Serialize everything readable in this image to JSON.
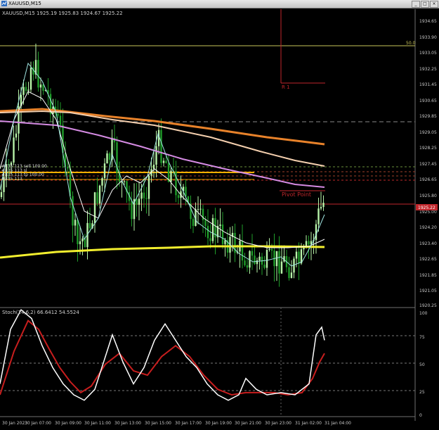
{
  "window": {
    "title": "XAUUSD,M15",
    "buttons": {
      "minimize": "_",
      "restore": "□",
      "close": "×"
    }
  },
  "main_panel": {
    "header": "XAUUSD,M15  1925.19 1925.83 1924.67 1925.22",
    "price_axis": [
      "1934.65",
      "1933.90",
      "1933.05",
      "1932.25",
      "1931.45",
      "1930.65",
      "1929.85",
      "1929.05",
      "1928.25",
      "1927.45",
      "1926.65",
      "1925.80",
      "1925.00",
      "1924.20",
      "1923.40",
      "1922.65",
      "1921.85",
      "1921.05",
      "1920.25"
    ],
    "current_price": "1925.22",
    "level_50": "50.0",
    "pivot_label": "Pivot Point",
    "r1_label": "R 1",
    "order_labels": [
      "#835 113 sell 100.00",
      "#835 113 sl",
      "#835 113 tp 100.00",
      "#835 113"
    ]
  },
  "oscillator_panel": {
    "header": "Stoch(14,6,2) 66.6412 54.5524",
    "levels": [
      "100",
      "75",
      "50",
      "25",
      "0"
    ]
  },
  "time_axis": [
    "30 Jan 2023",
    "30 Jan 07:00",
    "30 Jan 09:00",
    "30 Jan 11:00",
    "30 Jan 13:00",
    "30 Jan 15:00",
    "30 Jan 17:00",
    "30 Jan 19:00",
    "30 Jan 21:00",
    "30 Jan 23:00",
    "31 Jan 02:00",
    "31 Jan 04:00"
  ],
  "colors": {
    "background": "#000000",
    "bull_candle": "#b7f3a8",
    "bear_candle": "#1f9e2a",
    "ma_orange": "#e8822a",
    "ma_peach": "#f4cfae",
    "ma_violet": "#d58be3",
    "ma_yellow": "#f2ee2e",
    "ma_white": "#ffffff",
    "ma_cyan": "#9fe4e0",
    "stoch_main": "#ffffff",
    "stoch_signal": "#c81e1e",
    "current_price_line": "#c0262b"
  }
}
